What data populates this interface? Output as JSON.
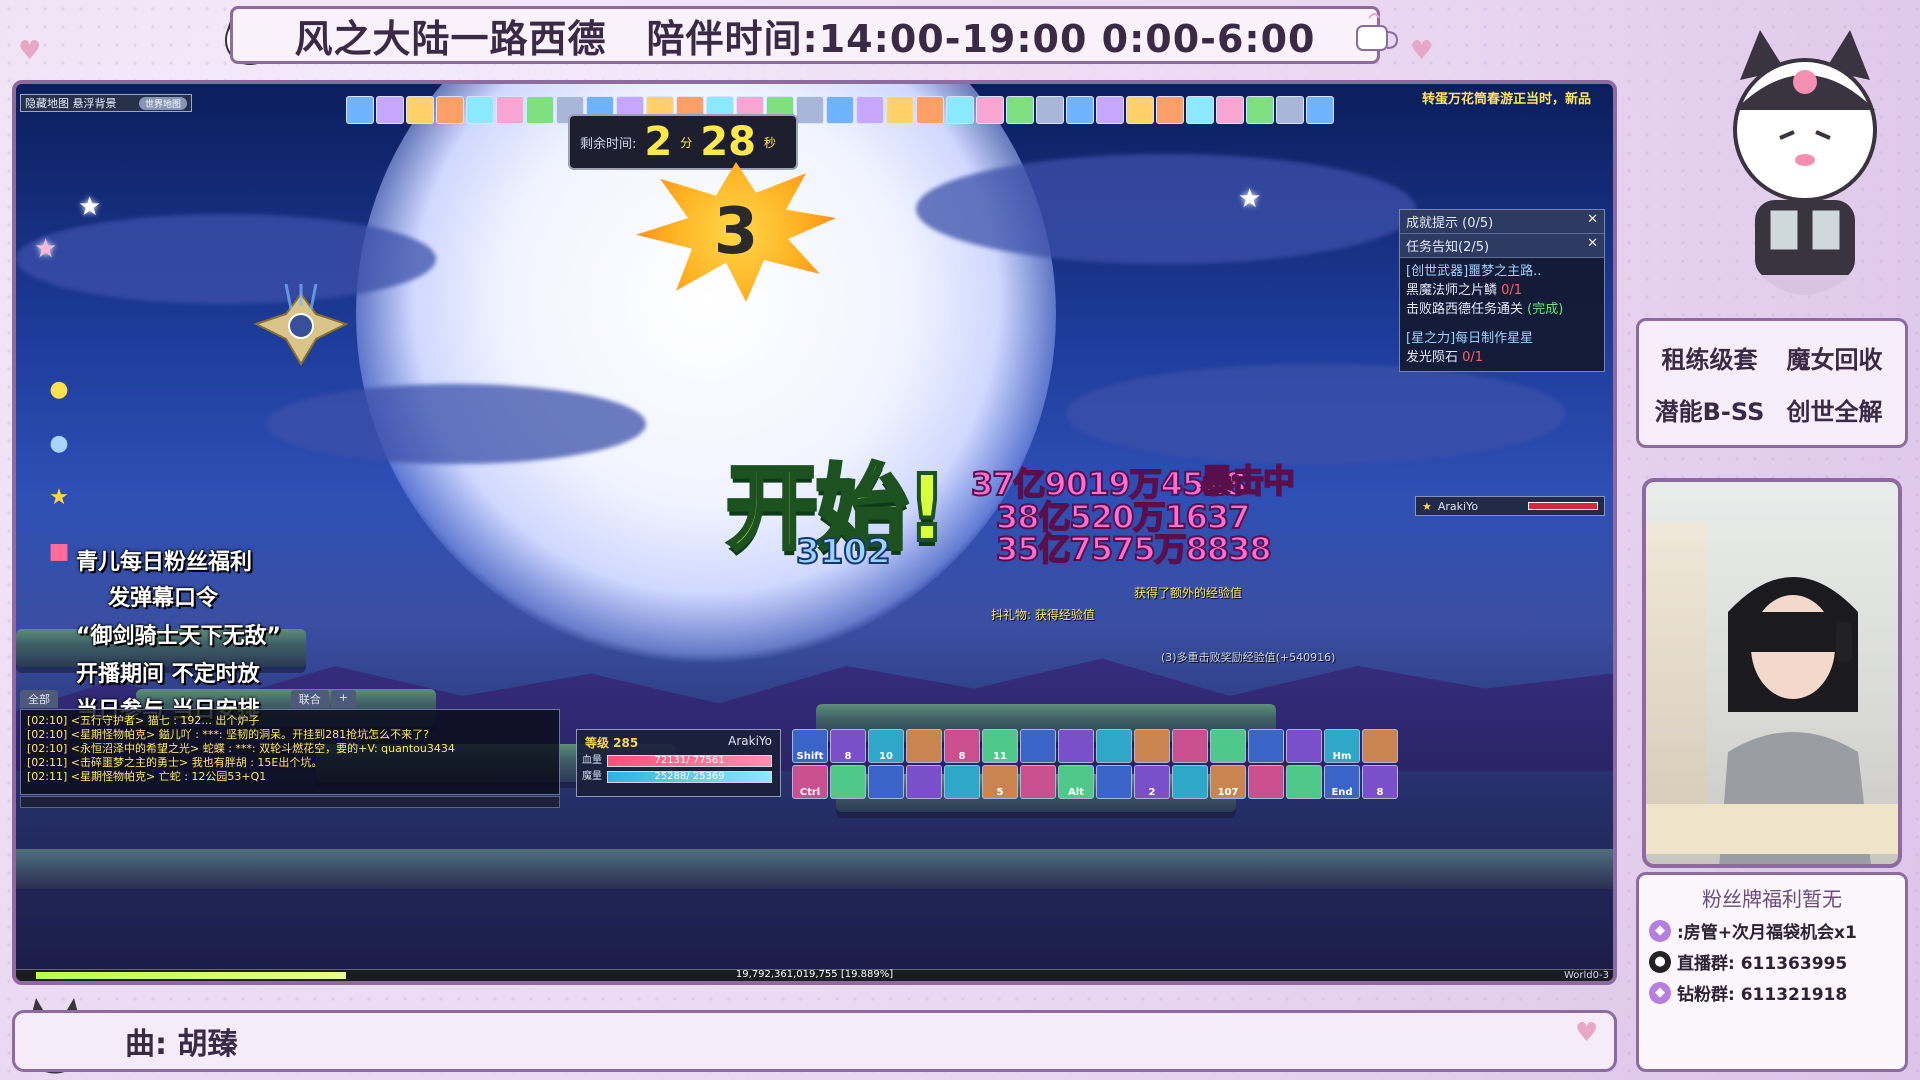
{
  "banner": {
    "title": "风之大陆一路西德",
    "schedule": "陪伴时间:14:00-19:00 0:00-6:00"
  },
  "game": {
    "minimap": {
      "label": "隐藏地图 悬浮背景",
      "button": "世界地图"
    },
    "event_ticker": "转蛋万花筒春游正当时，新品",
    "timer": {
      "label": "剩余时间:",
      "minutes": "2",
      "min_unit": "分",
      "seconds": "28",
      "sec_unit": "秒"
    },
    "countdown": "3",
    "start_text": "开始!",
    "damage": [
      "37亿9019万4528",
      "38亿520万1637",
      "35亿7575万8838"
    ],
    "crit_tag": "暴击中",
    "small_damage": "3102",
    "quest_panel": {
      "header1": "成就提示 (0/5)",
      "header2": "任务告知(2/5)",
      "quests": [
        {
          "title": "[创世武器]噩梦之主路..",
          "lines": [
            {
              "text": "黑魔法师之片鳞",
              "count": "0/1"
            },
            {
              "text": "击败路西德任务通关",
              "count": "(完成)"
            }
          ]
        },
        {
          "title": "[星之力]每日制作星星",
          "lines": [
            {
              "text": "发光陨石",
              "count": "0/1"
            }
          ]
        }
      ]
    },
    "target_name": "ArakiYo",
    "overlay_lines": [
      "青儿每日粉丝福利",
      "发弹幕口令",
      "“御剑骑士天下无敌”",
      "开播期间  不定时放",
      "当日参与  当日安排"
    ],
    "chat_tabs": [
      "全部",
      "联合"
    ],
    "chat": [
      "[02:10] <五行守护者> 猫七 : 192... 出个炉子",
      "[02:10] <星期怪物帕克> 鎰儿吖 : ***: 坚韧的洞呆。开挂到281抢坑怎么不来了?",
      "[02:10] <永恒沼泽中的希望之光> 蛇蝶 : ***: 双轮斗燃花空，要的+V: quantou3434",
      "[02:11] <击碎噩梦之主的勇士> 我也有胖胡 : 15E出个坑。",
      "[02:11] <星期怪物帕克> 亡蛇 : 12公园53+Q1"
    ],
    "status": {
      "level_label": "等级 285",
      "name": "ArakiYo",
      "hp_label": "血量",
      "hp": "72131/ 77561",
      "mp_label": "魔量",
      "mp": "25288/ 25369",
      "hp_fraction": 0.93,
      "mp_fraction": 0.99
    },
    "skills": [
      "Shift",
      "8",
      "10",
      "",
      "8",
      "11",
      "",
      "",
      "",
      "",
      "",
      "",
      "",
      "",
      "Hm",
      "",
      "Ctrl",
      "",
      "",
      "",
      "",
      "5",
      "",
      "Alt",
      "",
      "2",
      "",
      "107",
      "",
      "",
      "End",
      "8"
    ],
    "exp": {
      "text": "19,792,361,019,755 [19.889%]",
      "fraction": 0.19889
    },
    "world": "World0-3",
    "exp_msgs": [
      "获得了额外的经验值",
      "抖礼物: 获得经验值",
      "(3)多重击败奖励经验值(+540916)"
    ]
  },
  "right": {
    "tags": [
      "租练级套",
      "魔女回收",
      "潜能B-SS",
      "创世全解"
    ],
    "fan_title": "粉丝牌福利暂无",
    "fan_rows": [
      {
        "icon": "diamond-icon",
        "text": ":房管+次月福袋机会x1"
      },
      {
        "icon": "qq-icon",
        "text": "直播群: 611363995"
      },
      {
        "icon": "diamond-icon",
        "text": "钻粉群: 611321918"
      }
    ]
  },
  "song": "曲: 胡臻",
  "colors": {
    "frame": "#8d6aa0",
    "bg": "#ecdcf2",
    "start": "#d8ff3a",
    "damage": "#ff6fd2"
  }
}
